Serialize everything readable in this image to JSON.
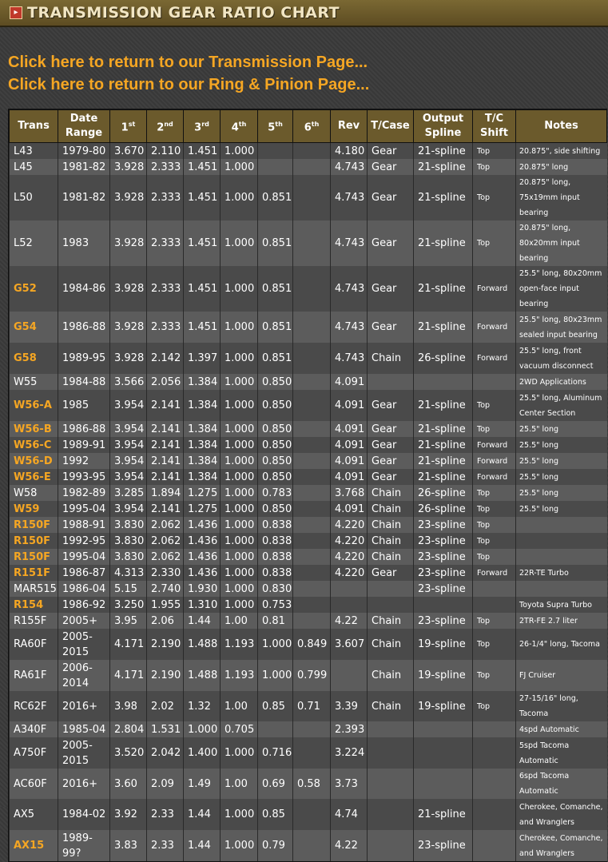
{
  "header": {
    "icon": "arrow-right-icon",
    "title": "TRANSMISSION GEAR RATIO CHART"
  },
  "links": [
    "Click here to return to our Transmission Page...",
    "Click here to return to our Ring & Pinion Page..."
  ],
  "table": {
    "columns": [
      {
        "label": "Trans"
      },
      {
        "label": "Date Range"
      },
      {
        "label": "1",
        "sup": "st"
      },
      {
        "label": "2",
        "sup": "nd"
      },
      {
        "label": "3",
        "sup": "rd"
      },
      {
        "label": "4",
        "sup": "th"
      },
      {
        "label": "5",
        "sup": "th"
      },
      {
        "label": "6",
        "sup": "th"
      },
      {
        "label": "Rev"
      },
      {
        "label": "T/Case"
      },
      {
        "label": "Output Spline"
      },
      {
        "label": "T/C Shift"
      },
      {
        "label": "Notes"
      }
    ],
    "rows": [
      {
        "trans": "L43",
        "link": false,
        "date": "1979-80",
        "g1": "3.670",
        "g2": "2.110",
        "g3": "1.451",
        "g4": "1.000",
        "g5": "",
        "g6": "",
        "rev": "4.180",
        "tcase": "Gear",
        "spline": "21-spline",
        "shift": "Top",
        "notes": "20.875\", side shifting",
        "tall": false
      },
      {
        "trans": "L45",
        "link": false,
        "date": "1981-82",
        "g1": "3.928",
        "g2": "2.333",
        "g3": "1.451",
        "g4": "1.000",
        "g5": "",
        "g6": "",
        "rev": "4.743",
        "tcase": "Gear",
        "spline": "21-spline",
        "shift": "Top",
        "notes": "20.875\" long",
        "tall": false
      },
      {
        "trans": "L50",
        "link": false,
        "date": "1981-82",
        "g1": "3.928",
        "g2": "2.333",
        "g3": "1.451",
        "g4": "1.000",
        "g5": "0.851",
        "g6": "",
        "rev": "4.743",
        "tcase": "Gear",
        "spline": "21-spline",
        "shift": "Top",
        "notes": "20.875\" long, 75x19mm input bearing",
        "tall": true
      },
      {
        "trans": "L52",
        "link": false,
        "date": "1983",
        "g1": "3.928",
        "g2": "2.333",
        "g3": "1.451",
        "g4": "1.000",
        "g5": "0.851",
        "g6": "",
        "rev": "4.743",
        "tcase": "Gear",
        "spline": "21-spline",
        "shift": "Top",
        "notes": "20.875\" long, 80x20mm input bearing",
        "tall": true
      },
      {
        "trans": "G52",
        "link": true,
        "date": "1984-86",
        "g1": "3.928",
        "g2": "2.333",
        "g3": "1.451",
        "g4": "1.000",
        "g5": "0.851",
        "g6": "",
        "rev": "4.743",
        "tcase": "Gear",
        "spline": "21-spline",
        "shift": "Forward",
        "notes": "25.5\" long, 80x20mm open-face input bearing",
        "tall": true
      },
      {
        "trans": "G54",
        "link": true,
        "date": "1986-88",
        "g1": "3.928",
        "g2": "2.333",
        "g3": "1.451",
        "g4": "1.000",
        "g5": "0.851",
        "g6": "",
        "rev": "4.743",
        "tcase": "Gear",
        "spline": "21-spline",
        "shift": "Forward",
        "notes": "25.5\" long, 80x23mm sealed input bearing",
        "tall": true
      },
      {
        "trans": "G58",
        "link": true,
        "date": "1989-95",
        "g1": "3.928",
        "g2": "2.142",
        "g3": "1.397",
        "g4": "1.000",
        "g5": "0.851",
        "g6": "",
        "rev": "4.743",
        "tcase": "Chain",
        "spline": "26-spline",
        "shift": "Forward",
        "notes": "25.5\" long, front vacuum disconnect",
        "tall": true
      },
      {
        "trans": "W55",
        "link": false,
        "date": "1984-88",
        "g1": "3.566",
        "g2": "2.056",
        "g3": "1.384",
        "g4": "1.000",
        "g5": "0.850",
        "g6": "",
        "rev": "4.091",
        "tcase": "",
        "spline": "",
        "shift": "",
        "notes": "2WD Applications",
        "tall": false
      },
      {
        "trans": "W56-A",
        "link": true,
        "date": "1985",
        "g1": "3.954",
        "g2": "2.141",
        "g3": "1.384",
        "g4": "1.000",
        "g5": "0.850",
        "g6": "",
        "rev": "4.091",
        "tcase": "Gear",
        "spline": "21-spline",
        "shift": "Top",
        "notes": "25.5\" long, Aluminum Center Section",
        "tall": true
      },
      {
        "trans": "W56-B",
        "link": true,
        "date": "1986-88",
        "g1": "3.954",
        "g2": "2.141",
        "g3": "1.384",
        "g4": "1.000",
        "g5": "0.850",
        "g6": "",
        "rev": "4.091",
        "tcase": "Gear",
        "spline": "21-spline",
        "shift": "Top",
        "notes": "25.5\" long",
        "tall": false
      },
      {
        "trans": "W56-C",
        "link": true,
        "date": "1989-91",
        "g1": "3.954",
        "g2": "2.141",
        "g3": "1.384",
        "g4": "1.000",
        "g5": "0.850",
        "g6": "",
        "rev": "4.091",
        "tcase": "Gear",
        "spline": "21-spline",
        "shift": "Forward",
        "notes": "25.5\" long",
        "tall": false
      },
      {
        "trans": "W56-D",
        "link": true,
        "date": "1992",
        "g1": "3.954",
        "g2": "2.141",
        "g3": "1.384",
        "g4": "1.000",
        "g5": "0.850",
        "g6": "",
        "rev": "4.091",
        "tcase": "Gear",
        "spline": "21-spline",
        "shift": "Forward",
        "notes": "25.5\" long",
        "tall": false
      },
      {
        "trans": "W56-E",
        "link": true,
        "date": "1993-95",
        "g1": "3.954",
        "g2": "2.141",
        "g3": "1.384",
        "g4": "1.000",
        "g5": "0.850",
        "g6": "",
        "rev": "4.091",
        "tcase": "Gear",
        "spline": "21-spline",
        "shift": "Forward",
        "notes": "25.5\" long",
        "tall": false
      },
      {
        "trans": "W58",
        "link": false,
        "date": "1982-89",
        "g1": "3.285",
        "g2": "1.894",
        "g3": "1.275",
        "g4": "1.000",
        "g5": "0.783",
        "g6": "",
        "rev": "3.768",
        "tcase": "Chain",
        "spline": "26-spline",
        "shift": "Top",
        "notes": "25.5\" long",
        "tall": false
      },
      {
        "trans": "W59",
        "link": true,
        "date": "1995-04",
        "g1": "3.954",
        "g2": "2.141",
        "g3": "1.275",
        "g4": "1.000",
        "g5": "0.850",
        "g6": "",
        "rev": "4.091",
        "tcase": "Chain",
        "spline": "26-spline",
        "shift": "Top",
        "notes": "25.5\" long",
        "tall": false
      },
      {
        "trans": "R150F",
        "link": true,
        "date": "1988-91",
        "g1": "3.830",
        "g2": "2.062",
        "g3": "1.436",
        "g4": "1.000",
        "g5": "0.838",
        "g6": "",
        "rev": "4.220",
        "tcase": "Chain",
        "spline": "23-spline",
        "shift": "Top",
        "notes": "",
        "tall": false
      },
      {
        "trans": "R150F",
        "link": true,
        "date": "1992-95",
        "g1": "3.830",
        "g2": "2.062",
        "g3": "1.436",
        "g4": "1.000",
        "g5": "0.838",
        "g6": "",
        "rev": "4.220",
        "tcase": "Chain",
        "spline": "23-spline",
        "shift": "Top",
        "notes": "",
        "tall": false
      },
      {
        "trans": "R150F",
        "link": true,
        "date": "1995-04",
        "g1": "3.830",
        "g2": "2.062",
        "g3": "1.436",
        "g4": "1.000",
        "g5": "0.838",
        "g6": "",
        "rev": "4.220",
        "tcase": "Chain",
        "spline": "23-spline",
        "shift": "Top",
        "notes": "",
        "tall": false
      },
      {
        "trans": "R151F",
        "link": true,
        "date": "1986-87",
        "g1": "4.313",
        "g2": "2.330",
        "g3": "1.436",
        "g4": "1.000",
        "g5": "0.838",
        "g6": "",
        "rev": "4.220",
        "tcase": "Gear",
        "spline": "23-spline",
        "shift": "Forward",
        "notes": "22R-TE Turbo",
        "tall": false
      },
      {
        "trans": "MAR515",
        "link": false,
        "date": "1986-04",
        "g1": "5.15",
        "g2": "2.740",
        "g3": "1.930",
        "g4": "1.000",
        "g5": "0.830",
        "g6": "",
        "rev": "",
        "tcase": "",
        "spline": "23-spline",
        "shift": "",
        "notes": "",
        "tall": false
      },
      {
        "trans": "R154",
        "link": true,
        "date": "1986-92",
        "g1": "3.250",
        "g2": "1.955",
        "g3": "1.310",
        "g4": "1.000",
        "g5": "0.753",
        "g6": "",
        "rev": "",
        "tcase": "",
        "spline": "",
        "shift": "",
        "notes": "Toyota Supra Turbo",
        "tall": false
      },
      {
        "trans": "R155F",
        "link": false,
        "date": "2005+",
        "g1": "3.95",
        "g2": "2.06",
        "g3": "1.44",
        "g4": "1.00",
        "g5": "0.81",
        "g6": "",
        "rev": "4.22",
        "tcase": "Chain",
        "spline": "23-spline",
        "shift": "Top",
        "notes": "2TR-FE 2.7 liter",
        "tall": false
      },
      {
        "trans": "RA60F",
        "link": false,
        "date": "2005-2015",
        "g1": "4.171",
        "g2": "2.190",
        "g3": "1.488",
        "g4": "1.193",
        "g5": "1.000",
        "g6": "0.849",
        "rev": "3.607",
        "tcase": "Chain",
        "spline": "19-spline",
        "shift": "Top",
        "notes": "26-1/4\" long, Tacoma",
        "tall": true
      },
      {
        "trans": "RA61F",
        "link": false,
        "date": "2006-2014",
        "g1": "4.171",
        "g2": "2.190",
        "g3": "1.488",
        "g4": "1.193",
        "g5": "1.000",
        "g6": "0.799",
        "rev": "",
        "tcase": "Chain",
        "spline": "19-spline",
        "shift": "Top",
        "notes": "FJ Cruiser",
        "tall": true
      },
      {
        "trans": "RC62F",
        "link": false,
        "date": "2016+",
        "g1": "3.98",
        "g2": "2.02",
        "g3": "1.32",
        "g4": "1.00",
        "g5": "0.85",
        "g6": "0.71",
        "rev": "3.39",
        "tcase": "Chain",
        "spline": "19-spline",
        "shift": "Top",
        "notes": "27-15/16\" long, Tacoma",
        "tall": false
      },
      {
        "trans": "A340F",
        "link": false,
        "date": "1985-04",
        "g1": "2.804",
        "g2": "1.531",
        "g3": "1.000",
        "g4": "0.705",
        "g5": "",
        "g6": "",
        "rev": "2.393",
        "tcase": "",
        "spline": "",
        "shift": "",
        "notes": "4spd Automatic",
        "tall": false
      },
      {
        "trans": "A750F",
        "link": false,
        "date": "2005-2015",
        "g1": "3.520",
        "g2": "2.042",
        "g3": "1.400",
        "g4": "1.000",
        "g5": "0.716",
        "g6": "",
        "rev": "3.224",
        "tcase": "",
        "spline": "",
        "shift": "",
        "notes": "5spd Tacoma Automatic",
        "tall": true
      },
      {
        "trans": "AC60F",
        "link": false,
        "date": "2016+",
        "g1": "3.60",
        "g2": "2.09",
        "g3": "1.49",
        "g4": "1.00",
        "g5": "0.69",
        "g6": "0.58",
        "rev": "3.73",
        "tcase": "",
        "spline": "",
        "shift": "",
        "notes": "6spd Tacoma Automatic",
        "tall": false
      },
      {
        "trans": "AX5",
        "link": false,
        "date": "1984-02",
        "g1": "3.92",
        "g2": "2.33",
        "g3": "1.44",
        "g4": "1.000",
        "g5": "0.85",
        "g6": "",
        "rev": "4.74",
        "tcase": "",
        "spline": "21-spline",
        "shift": "",
        "notes": "Cherokee, Comanche, and Wranglers",
        "tall": true
      },
      {
        "trans": "AX15",
        "link": true,
        "date": "1989-99?",
        "g1": "3.83",
        "g2": "2.33",
        "g3": "1.44",
        "g4": "1.000",
        "g5": "0.79",
        "g6": "",
        "rev": "4.22",
        "tcase": "",
        "spline": "23-spline",
        "shift": "",
        "notes": "Cherokee, Comanche, and Wranglers",
        "tall": true
      }
    ]
  }
}
